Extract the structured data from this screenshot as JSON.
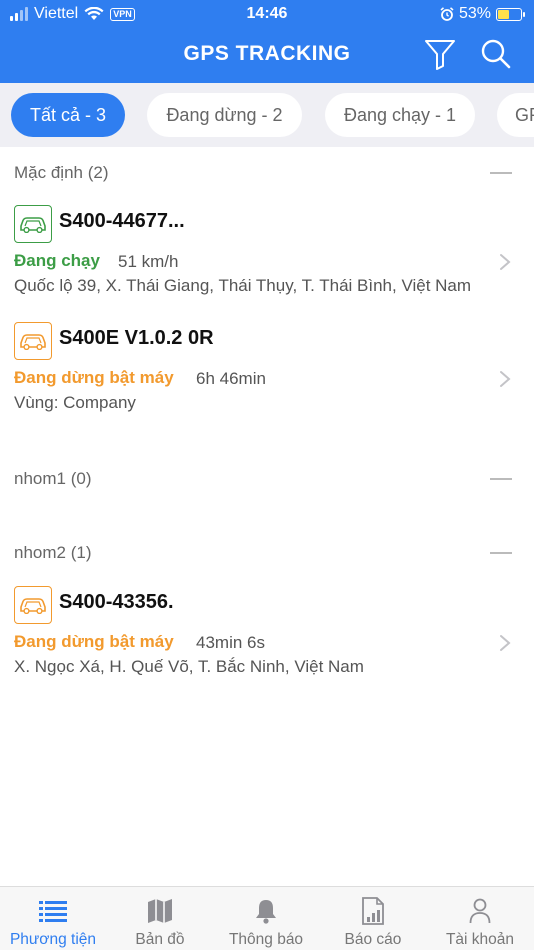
{
  "status_bar": {
    "carrier": "Viettel",
    "vpn": "VPN",
    "time": "14:46",
    "battery": "53%",
    "battery_level": 0.53
  },
  "header": {
    "title": "GPS TRACKING",
    "filter_icon": "filter-icon",
    "search_icon": "search-icon"
  },
  "filter_tabs": [
    {
      "label": "Tất cả - 3",
      "active": true
    },
    {
      "label": "Đang dừng - 2",
      "active": false
    },
    {
      "label": "Đang chạy - 1",
      "active": false
    },
    {
      "label": "GP",
      "active": false
    }
  ],
  "groups": [
    {
      "label": "Mặc định (2)",
      "vehicles": [
        {
          "name": "S400-44677...",
          "status": "Đang chạy",
          "status_color": "#3c9d46",
          "meta": "51 km/h",
          "address": "Quốc lộ 39, X. Thái Giang, Thái Thụy, T. Thái Bình, Việt Nam"
        },
        {
          "name": "S400E V1.0.2 0R",
          "status": "Đang dừng bật máy",
          "status_color": "#f29a2e",
          "meta": "6h 46min",
          "address": "Vùng: Company"
        }
      ]
    },
    {
      "label": "nhom1 (0)",
      "vehicles": []
    },
    {
      "label": "nhom2 (1)",
      "vehicles": [
        {
          "name": "S400-43356.",
          "status": "Đang dừng bật máy",
          "status_color": "#f29a2e",
          "meta": "43min 6s",
          "address": "X. Ngọc Xá, H. Quế Võ, T. Bắc Ninh, Việt Nam"
        }
      ]
    }
  ],
  "tab_bar": [
    {
      "label": "Phương tiện",
      "icon": "list-icon",
      "active": true
    },
    {
      "label": "Bản đồ",
      "icon": "map-icon",
      "active": false
    },
    {
      "label": "Thông báo",
      "icon": "bell-icon",
      "active": false
    },
    {
      "label": "Báo cáo",
      "icon": "report-icon",
      "active": false
    },
    {
      "label": "Tài khoản",
      "icon": "user-icon",
      "active": false
    }
  ],
  "colors": {
    "primary": "#2f7ef0",
    "running": "#3c9d46",
    "stopped": "#f29a2e"
  }
}
